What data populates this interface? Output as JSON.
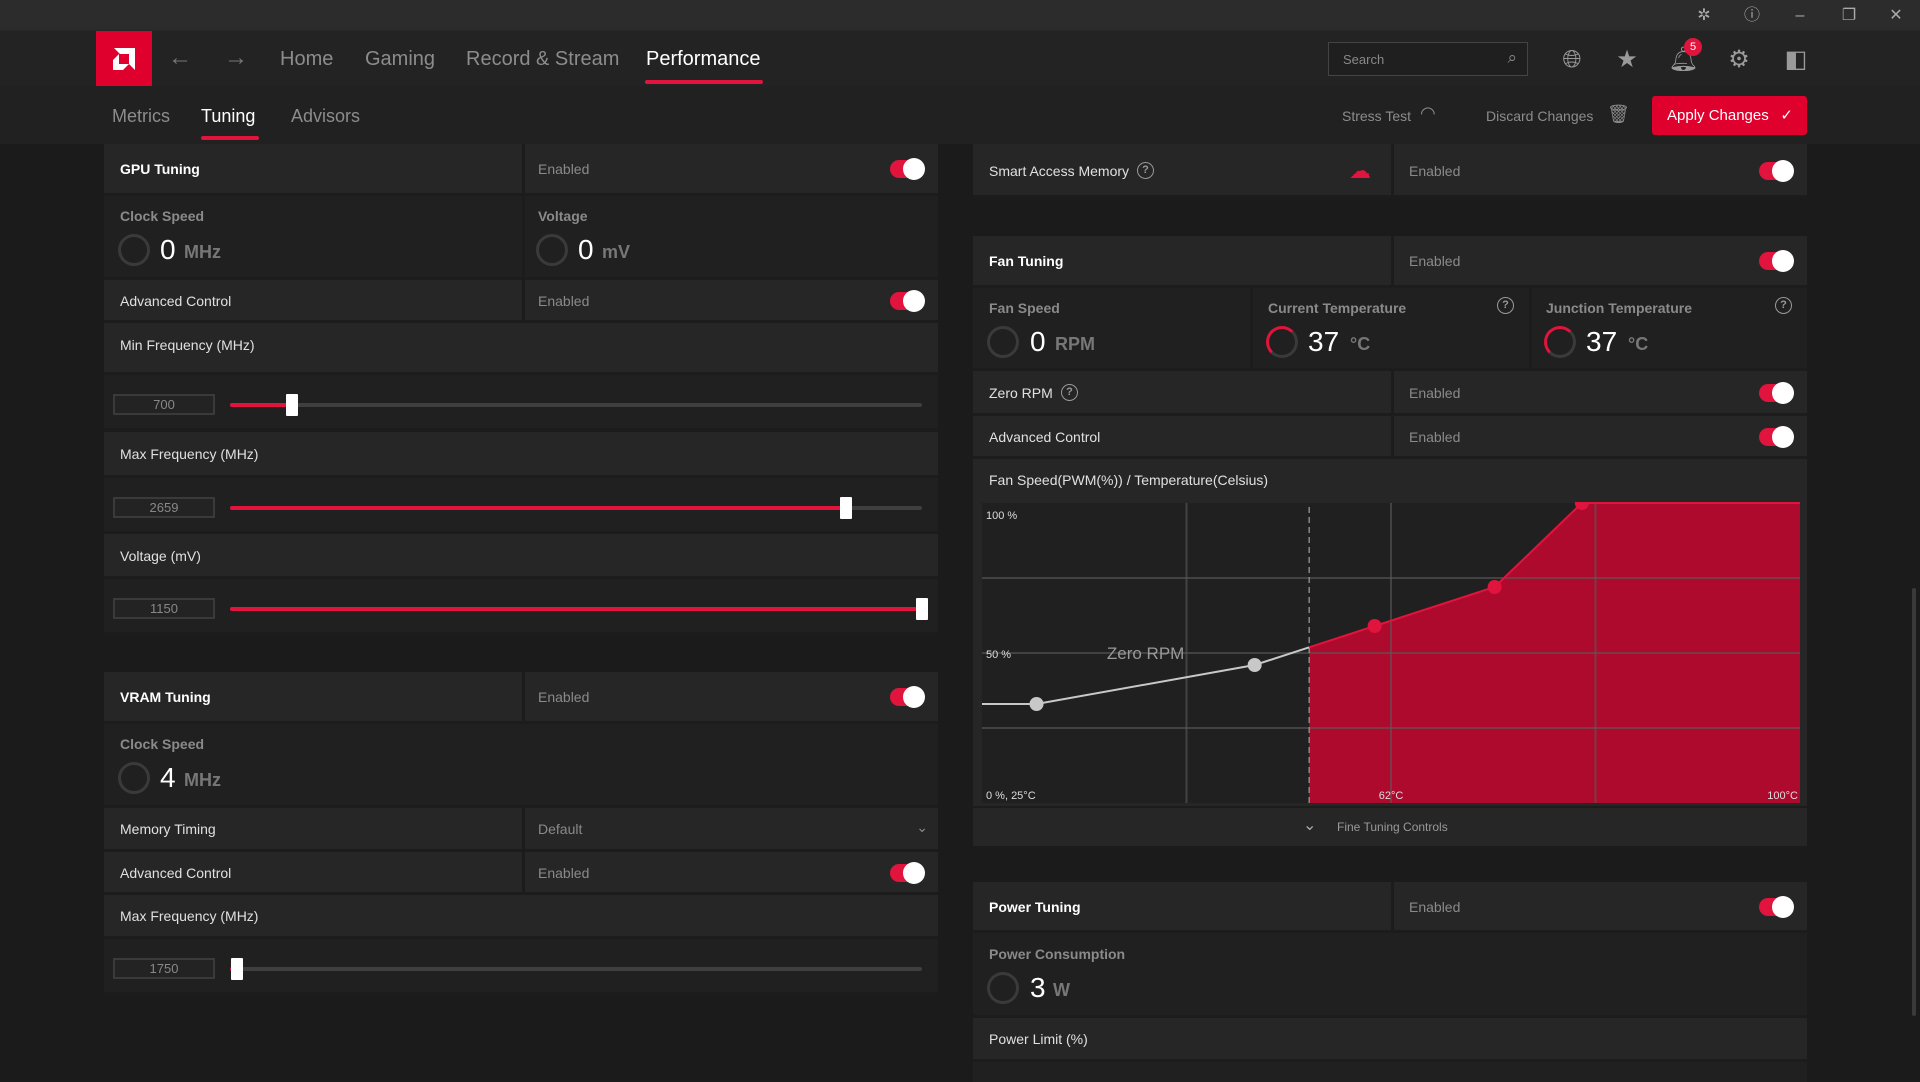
{
  "titlebar": {
    "icons": [
      "bug-icon",
      "help-icon",
      "minimize-icon",
      "restore-icon",
      "close-icon"
    ]
  },
  "nav": {
    "items": [
      "Home",
      "Gaming",
      "Record & Stream",
      "Performance"
    ],
    "active": "Performance",
    "search_placeholder": "Search",
    "notification_count": "5"
  },
  "subnav": {
    "tabs": [
      "Metrics",
      "Tuning",
      "Advisors"
    ],
    "active": "Tuning",
    "stress_test": "Stress Test",
    "discard": "Discard Changes",
    "apply": "Apply Changes"
  },
  "colors": {
    "accent": "#e0143c",
    "chart_fill": "#ae0a2e"
  },
  "gpu": {
    "title": "GPU Tuning",
    "status": "Enabled",
    "clock_label": "Clock Speed",
    "clock_value": "0",
    "clock_unit": "MHz",
    "voltage_label": "Voltage",
    "voltage_value": "0",
    "voltage_unit": "mV",
    "adv_label": "Advanced Control",
    "adv_status": "Enabled",
    "sliders": [
      {
        "label": "Min Frequency (MHz)",
        "value": "700",
        "fill_percent": 9
      },
      {
        "label": "Max Frequency (MHz)",
        "value": "2659",
        "fill_percent": 89
      },
      {
        "label": "Voltage (mV)",
        "value": "1150",
        "fill_percent": 100
      }
    ]
  },
  "vram": {
    "title": "VRAM Tuning",
    "status": "Enabled",
    "clock_label": "Clock Speed",
    "clock_value": "4",
    "clock_unit": "MHz",
    "timing_label": "Memory Timing",
    "timing_value": "Default",
    "adv_label": "Advanced Control",
    "adv_status": "Enabled",
    "slider": {
      "label": "Max Frequency (MHz)",
      "value": "1750",
      "fill_percent": 1
    }
  },
  "sam": {
    "label": "Smart Access Memory",
    "status": "Enabled"
  },
  "fan": {
    "title": "Fan Tuning",
    "status": "Enabled",
    "speed_label": "Fan Speed",
    "speed_value": "0",
    "speed_unit": "RPM",
    "cur_temp_label": "Current Temperature",
    "cur_temp_value": "37",
    "jn_temp_label": "Junction Temperature",
    "jn_temp_value": "37",
    "temp_unit": "°C",
    "zero_rpm_label": "Zero RPM",
    "zero_rpm_status": "Enabled",
    "adv_label": "Advanced Control",
    "adv_status": "Enabled",
    "chart_title": "Fan Speed(PWM(%)) / Temperature(Celsius)",
    "fine_tuning": "Fine Tuning Controls"
  },
  "chart_data": {
    "type": "area",
    "x_unit": "°C",
    "y_unit": "%",
    "xlim": [
      25,
      100
    ],
    "ylim": [
      0,
      100
    ],
    "grid": true,
    "labels": {
      "y_top": "100 %",
      "y_mid": "50 %",
      "origin": "0 %, 25°C",
      "x_mid": "62°C",
      "x_max": "100°C",
      "zero_rpm": "Zero RPM"
    },
    "zero_rpm_threshold": 55,
    "points": [
      {
        "x": 30,
        "y": 33
      },
      {
        "x": 50,
        "y": 46
      },
      {
        "x": 61,
        "y": 59
      },
      {
        "x": 72,
        "y": 72
      },
      {
        "x": 80,
        "y": 100
      }
    ]
  },
  "power": {
    "title": "Power Tuning",
    "status": "Enabled",
    "consumption_label": "Power Consumption",
    "consumption_value": "3",
    "consumption_unit": "W",
    "limit_label": "Power Limit (%)"
  }
}
